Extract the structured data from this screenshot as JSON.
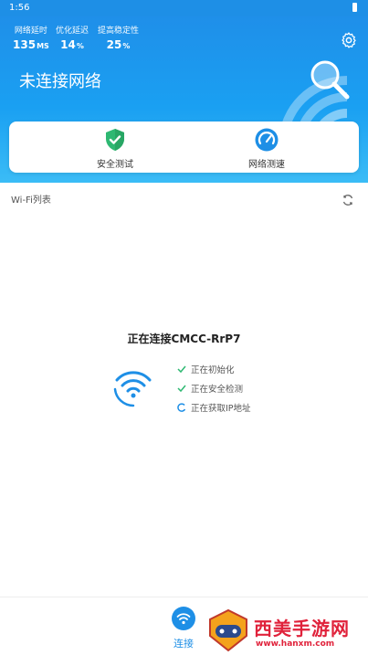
{
  "status_bar": {
    "time": "1:56"
  },
  "header": {
    "stats": [
      {
        "label": "网络延时",
        "value": "135",
        "unit": "MS"
      },
      {
        "label": "优化延迟",
        "value": "14",
        "unit": "%"
      },
      {
        "label": "提高稳定性",
        "value": "25",
        "unit": "%"
      }
    ],
    "title": "未连接网络"
  },
  "features": [
    {
      "label": "安全测试",
      "icon": "shield-check-icon"
    },
    {
      "label": "网络测速",
      "icon": "speedometer-icon"
    }
  ],
  "wifi_list": {
    "title": "Wi-Fi列表"
  },
  "connecting": {
    "title": "正在连接CMCC-RrP7",
    "steps": [
      {
        "label": "正在初始化",
        "state": "done"
      },
      {
        "label": "正在安全检测",
        "state": "done"
      },
      {
        "label": "正在获取IP地址",
        "state": "loading"
      }
    ]
  },
  "bottom_nav": {
    "items": [
      {
        "label": "连接",
        "icon": "wifi-icon"
      }
    ]
  },
  "watermark": {
    "text": "西美手游网",
    "url": "www.hanxm.com"
  },
  "colors": {
    "primary": "#1e8fe6",
    "check": "#2eb872",
    "watermark": "#e0223b"
  }
}
